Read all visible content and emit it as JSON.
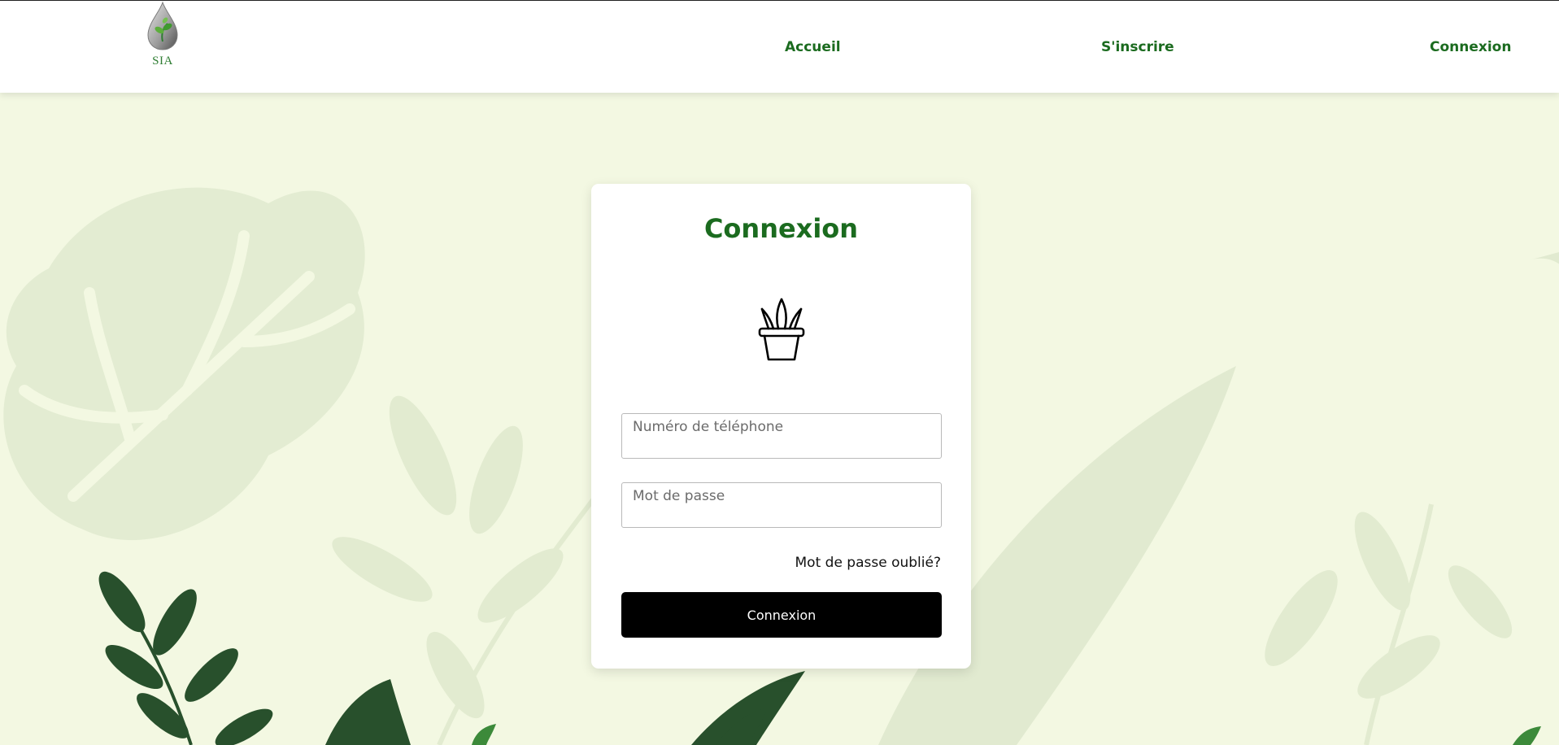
{
  "brand": {
    "name": "SIA",
    "logo_icon": "water-drop-leaf-icon"
  },
  "nav": {
    "home": "Accueil",
    "signup": "S'inscrire",
    "login": "Connexion"
  },
  "login_card": {
    "title": "Connexion",
    "icon": "potted-plant-icon",
    "phone_placeholder": "Numéro de téléphone",
    "password_placeholder": "Mot de passe",
    "forgot_password": "Mot de passe oublié?",
    "submit_label": "Connexion"
  },
  "colors": {
    "accent_green": "#1b6b1f",
    "background": "#f3f8e2",
    "button": "#000000"
  }
}
